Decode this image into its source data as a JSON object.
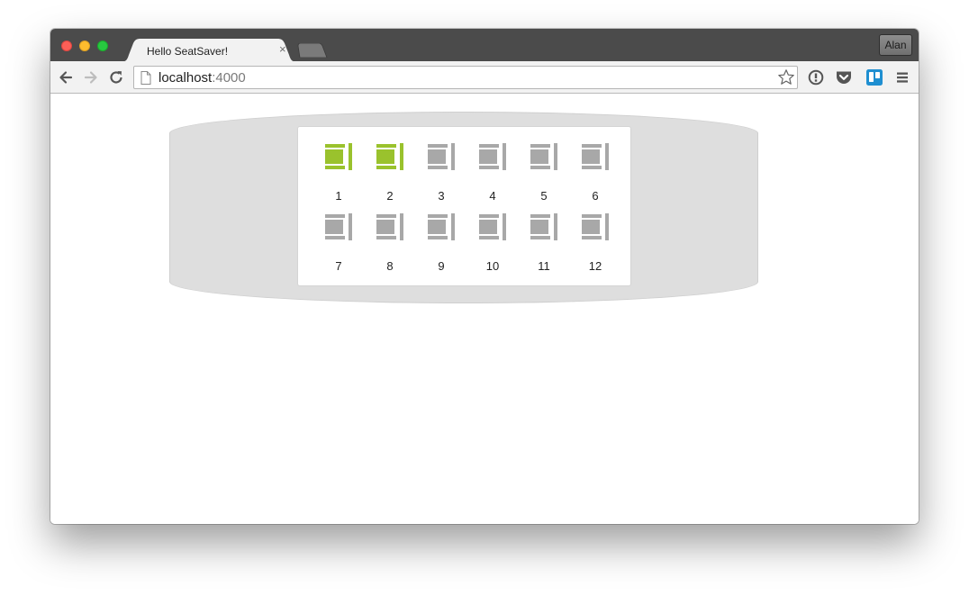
{
  "browser": {
    "tab": {
      "title": "Hello SeatSaver!",
      "close": "×"
    },
    "profile": "Alan",
    "address": {
      "host": "localhost",
      "port": ":4000"
    }
  },
  "icons": {
    "back": "arrow-left-icon",
    "forward": "arrow-right-icon",
    "reload": "reload-icon",
    "page": "page-icon",
    "bookmark": "star-icon",
    "extensions": [
      "info-circle-icon",
      "pocket-icon",
      "trello-icon"
    ],
    "menu": "hamburger-menu-icon"
  },
  "colors": {
    "seat_occupied": "#9ac22d",
    "seat_available": "#a8a8a8",
    "plane": "#dedede",
    "trello": "#1f8fd1"
  },
  "seats": [
    {
      "label": "1",
      "occupied": true
    },
    {
      "label": "2",
      "occupied": true
    },
    {
      "label": "3",
      "occupied": false
    },
    {
      "label": "4",
      "occupied": false
    },
    {
      "label": "5",
      "occupied": false
    },
    {
      "label": "6",
      "occupied": false
    },
    {
      "label": "7",
      "occupied": false
    },
    {
      "label": "8",
      "occupied": false
    },
    {
      "label": "9",
      "occupied": false
    },
    {
      "label": "10",
      "occupied": false
    },
    {
      "label": "11",
      "occupied": false
    },
    {
      "label": "12",
      "occupied": false
    }
  ]
}
